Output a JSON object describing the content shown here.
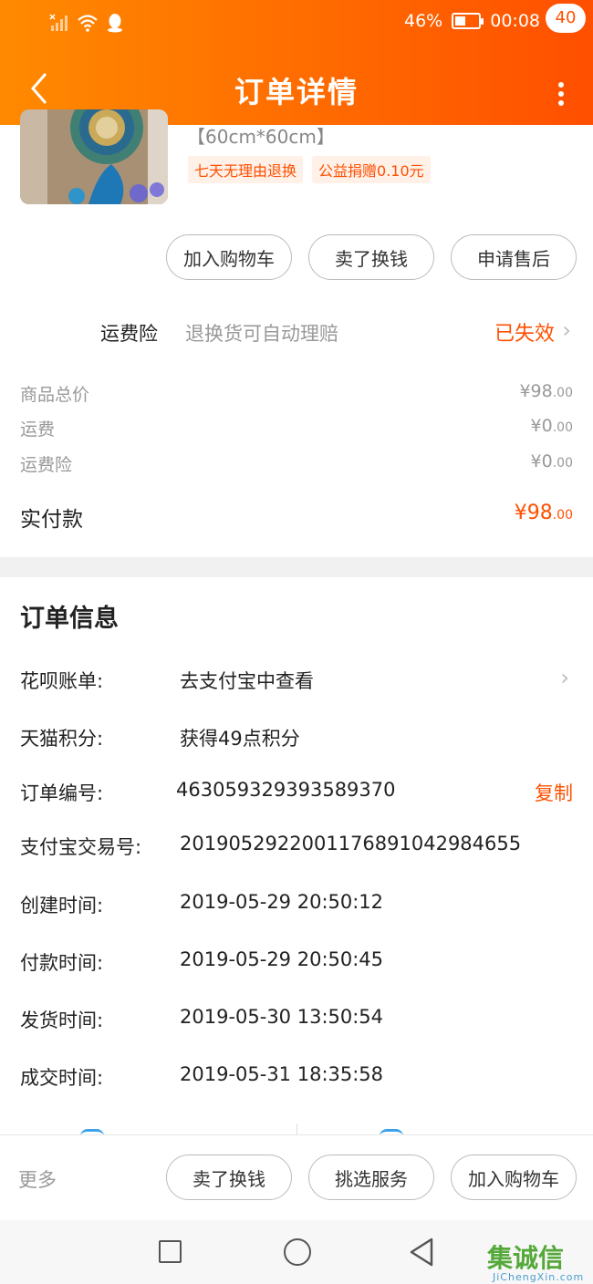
{
  "status_bar": {
    "battery": "46%",
    "battery_level": 0.46,
    "time": "00:08"
  },
  "nav": {
    "title": "订单详情",
    "badge": "40"
  },
  "product": {
    "spec": "【60cm*60cm】",
    "tags": [
      "七天无理由退换",
      "公益捐赠0.10元"
    ]
  },
  "actions_top": [
    "加入购物车",
    "卖了换钱",
    "申请售后"
  ],
  "insurance": {
    "label": "运费险",
    "desc": "退换货可自动理赔",
    "status": "已失效"
  },
  "price_rows": [
    {
      "label": "商品总价",
      "int": "¥98",
      "dec": ".00"
    },
    {
      "label": "运费",
      "int": "¥0",
      "dec": ".00"
    },
    {
      "label": "运费险",
      "int": "¥0",
      "dec": ".00"
    }
  ],
  "total": {
    "label": "实付款",
    "int": "¥98",
    "dec": ".00"
  },
  "order_info": {
    "title": "订单信息",
    "rows": [
      {
        "label": "花呗账单:",
        "value": "去支付宝中查看"
      },
      {
        "label": "天猫积分:",
        "value": "获得49点积分"
      },
      {
        "label": "订单编号:",
        "value": "463059329393589370",
        "action": "复制"
      },
      {
        "label": "支付宝交易号:",
        "value": "2019052922001176891042984655"
      },
      {
        "label": "创建时间:",
        "value": "2019-05-29 20:50:12"
      },
      {
        "label": "付款时间:",
        "value": "2019-05-29 20:50:45"
      },
      {
        "label": "发货时间:",
        "value": "2019-05-30 13:50:54"
      },
      {
        "label": "成交时间:",
        "value": "2019-05-31 18:35:58"
      }
    ]
  },
  "bottom_bar": {
    "more": "更多",
    "buttons": [
      "卖了换钱",
      "挑选服务",
      "加入购物车"
    ]
  },
  "watermark": {
    "logo": "集诚信",
    "url": "JiChengXin.com"
  },
  "colors": {
    "accent": "#ff5000",
    "header_start": "#ff8a00",
    "header_end": "#ff4f00"
  }
}
